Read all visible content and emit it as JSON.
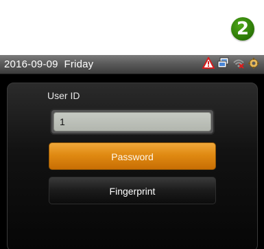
{
  "step_badge": {
    "label": "2",
    "color": "#2f7d08"
  },
  "status_bar": {
    "date": "2016-09-09",
    "weekday": "Friday",
    "icons": [
      "alert-icon",
      "network-icon",
      "wifi-off-icon",
      "settings-icon"
    ]
  },
  "form": {
    "user_id_label": "User ID",
    "user_id_value": "1"
  },
  "buttons": {
    "password_label": "Password",
    "fingerprint_label": "Fingerprint"
  },
  "colors": {
    "accent_orange": "#e08a12",
    "screen_bg": "#000000",
    "status_bar": "#5b5b5b",
    "input_bg": "#b8bcb4"
  }
}
